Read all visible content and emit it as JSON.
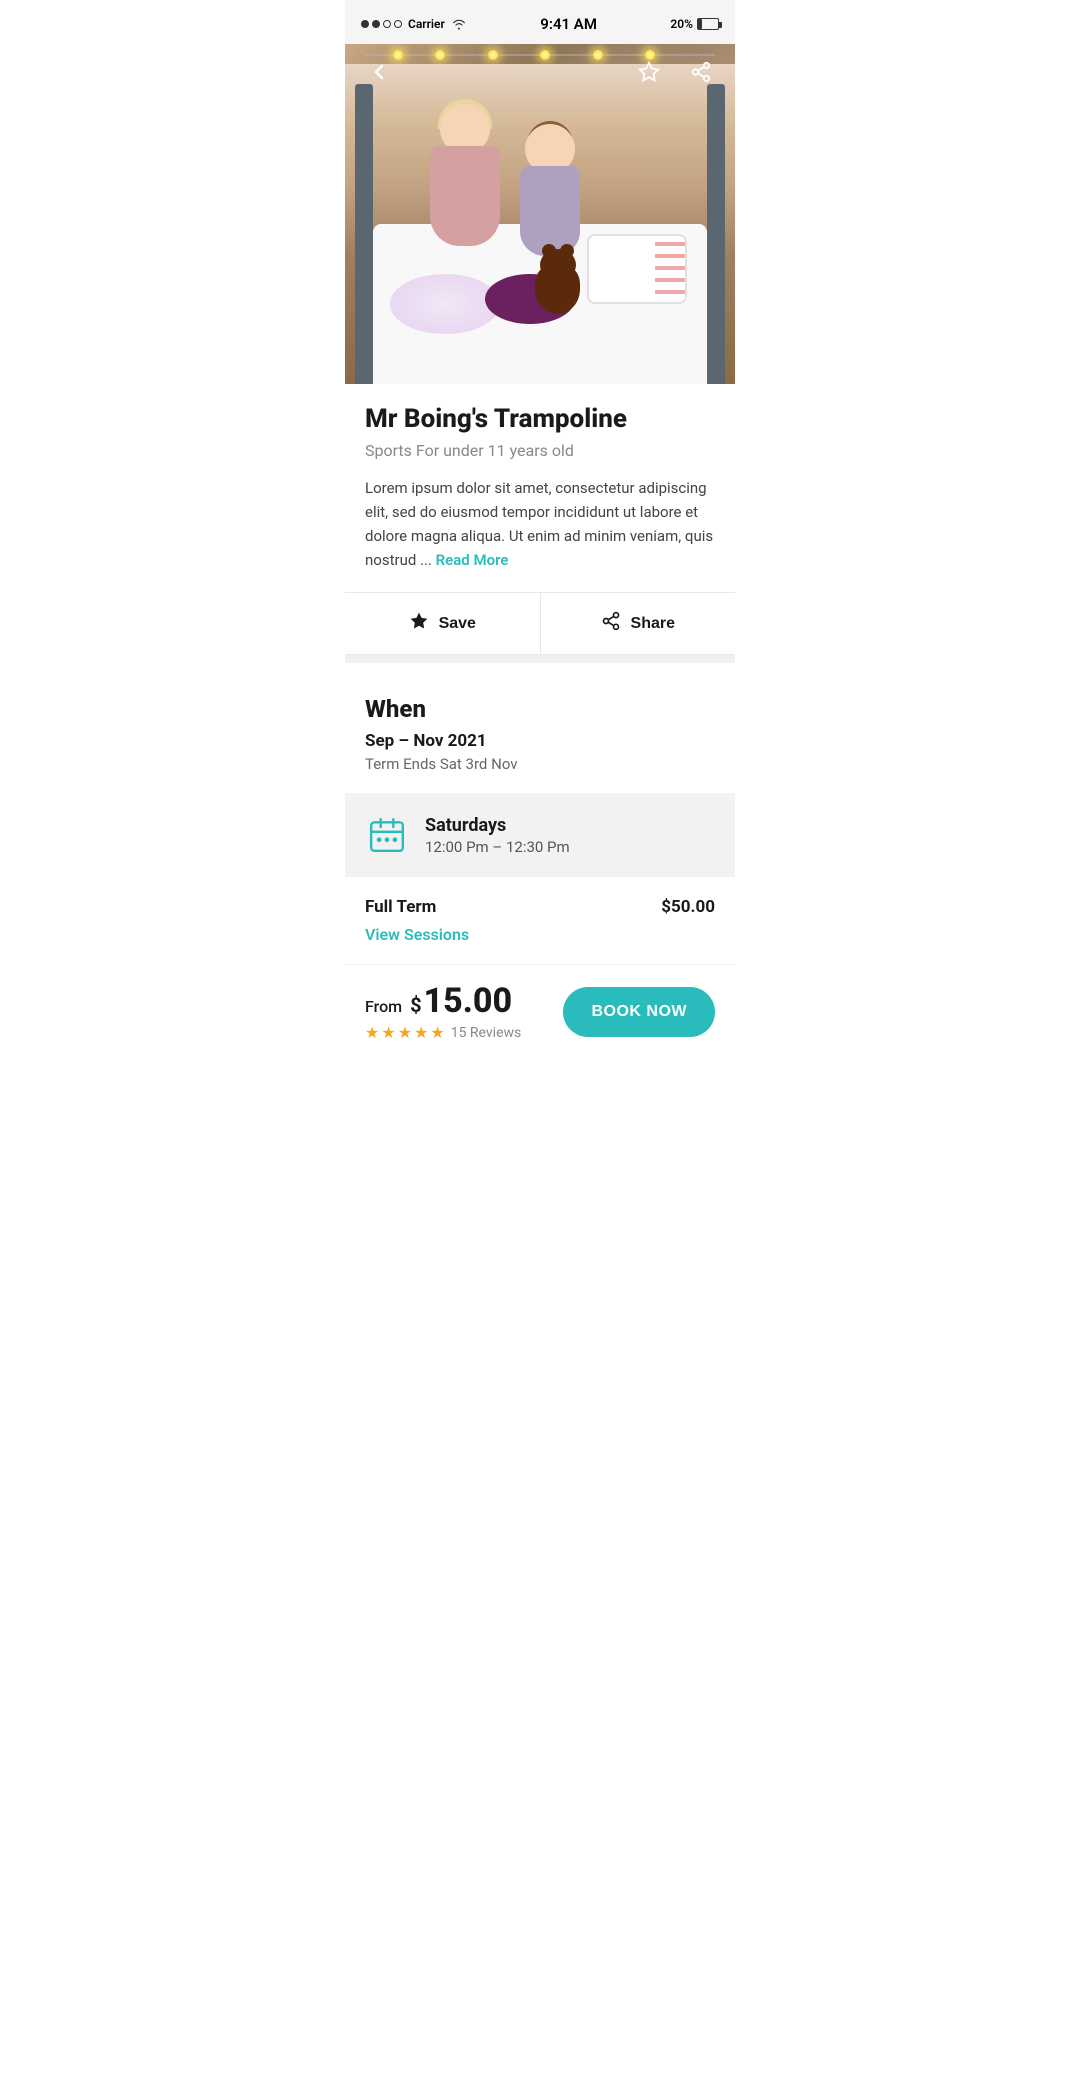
{
  "statusBar": {
    "carrier": "Carrier",
    "time": "9:41 AM",
    "battery": "20%"
  },
  "nav": {
    "back_label": "‹",
    "bookmark_label": "★",
    "share_label": "⎘"
  },
  "activity": {
    "title": "Mr Boing's Trampoline",
    "subtitle": "Sports For under 11 years old",
    "description": "Lorem ipsum dolor sit amet, consectetur adipiscing elit, sed do eiusmod tempor incididunt ut labore et dolore magna aliqua. Ut enim ad minim veniam, quis nostrud ...",
    "read_more_label": "Read More"
  },
  "actions": {
    "save_label": "Save",
    "share_label": "Share"
  },
  "when": {
    "section_title": "When",
    "date_range": "Sep – Nov 2021",
    "term_ends": "Term Ends Sat 3rd Nov",
    "day": "Saturdays",
    "time": "12:00 Pm – 12:30 Pm"
  },
  "pricing": {
    "full_term_label": "Full Term",
    "full_term_price": "$50.00",
    "view_sessions_label": "View Sessions"
  },
  "bottomBar": {
    "from_label": "From",
    "price_dollar": "$",
    "price": "15.00",
    "review_count": "15 Reviews",
    "book_now_label": "BOOK NOW",
    "stars": [
      "★",
      "★",
      "★",
      "★",
      "★"
    ]
  },
  "colors": {
    "teal": "#2abcbc",
    "star_gold": "#f5a623",
    "dark": "#1a1a1a",
    "gray_bg": "#f2f2f2"
  }
}
